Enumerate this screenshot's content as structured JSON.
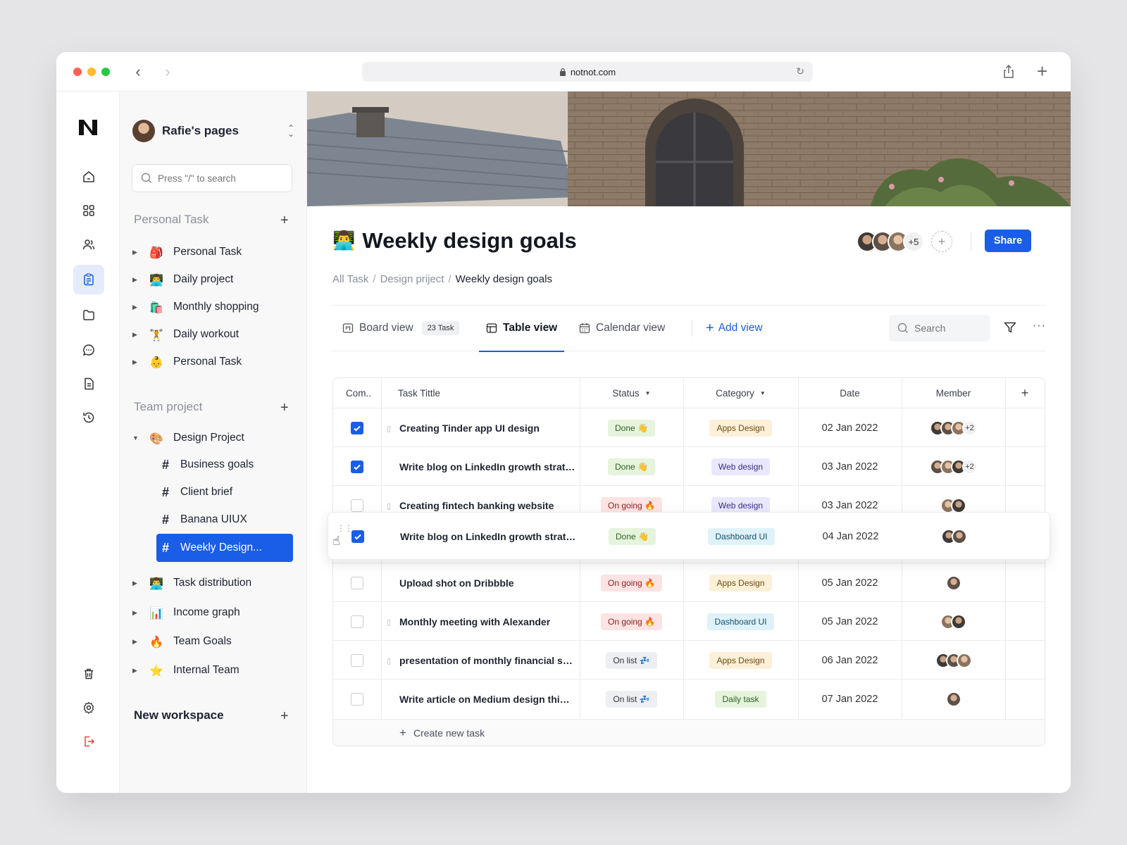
{
  "browser": {
    "url": "notnot.com"
  },
  "sidebar": {
    "workspace_name": "Rafie's pages",
    "search_placeholder": "Press \"/\" to search",
    "personal_section": "Personal Task",
    "personal_items": [
      {
        "label": "Personal Task",
        "emoji": "🎒"
      },
      {
        "label": "Daily project",
        "emoji": "👨‍💻"
      },
      {
        "label": "Monthly shopping",
        "emoji": "🛍️"
      },
      {
        "label": "Daily workout",
        "emoji": "🏋️"
      },
      {
        "label": "Personal Task",
        "emoji": "👶"
      }
    ],
    "team_section": "Team project",
    "design_project": {
      "label": "Design Project",
      "emoji": "🎨"
    },
    "design_subitems": [
      "Business goals",
      "Client brief",
      "Banana UIUX",
      "Weekly Design..."
    ],
    "team_items": [
      {
        "label": "Task distribution",
        "emoji": "👨‍💻"
      },
      {
        "label": "Income graph",
        "emoji": "📊"
      },
      {
        "label": "Team Goals",
        "emoji": "🔥"
      },
      {
        "label": "Internal Team",
        "emoji": "⭐"
      }
    ],
    "new_workspace": "New workspace"
  },
  "page": {
    "emoji": "👨‍💻",
    "title": "Weekly design goals",
    "collaborators_more": "+5",
    "share_label": "Share",
    "breadcrumb": [
      "All Task",
      "Design priject",
      "Weekly design goals"
    ]
  },
  "views": {
    "board": "Board view",
    "task_count": "23 Task",
    "table": "Table view",
    "calendar": "Calendar view",
    "add_view": "Add view",
    "search_placeholder": "Search"
  },
  "table": {
    "headers": {
      "complete": "Com..",
      "title": "Task Tittle",
      "status": "Status",
      "category": "Category",
      "date": "Date",
      "member": "Member"
    },
    "rows": [
      {
        "checked": true,
        "doc": true,
        "title": "Creating Tinder app UI design",
        "status": "Done 👋",
        "category": "Apps Design",
        "date": "02 Jan 2022",
        "members_extra": "+2"
      },
      {
        "checked": true,
        "doc": false,
        "title": "Write blog on LinkedIn growth strategy",
        "status": "Done 👋",
        "category": "Web design",
        "date": "03 Jan 2022",
        "members_extra": "+2"
      },
      {
        "checked": false,
        "doc": true,
        "title": "Creating fintech banking website",
        "status": "On going 🔥",
        "category": "Web design",
        "date": "03 Jan 2022",
        "members_extra": ""
      },
      {
        "checked": true,
        "doc": false,
        "title": "Write blog on LinkedIn growth strategy",
        "status": "Done 👋",
        "category": "Dashboard UI",
        "date": "04 Jan 2022",
        "members_extra": ""
      },
      {
        "checked": false,
        "doc": false,
        "title": "Upload shot on Dribbble",
        "status": "On going 🔥",
        "category": "Apps Design",
        "date": "05 Jan 2022",
        "members_extra": ""
      },
      {
        "checked": false,
        "doc": true,
        "title": "Monthly meeting with Alexander",
        "status": "On going 🔥",
        "category": "Dashboard UI",
        "date": "05 Jan 2022",
        "members_extra": ""
      },
      {
        "checked": false,
        "doc": true,
        "title": "presentation of monthly financial stat...",
        "status": "On list 💤",
        "category": "Apps Design",
        "date": "06 Jan 2022",
        "members_extra": ""
      },
      {
        "checked": false,
        "doc": false,
        "title": "Write article on Medium design thinki...",
        "status": "On list 💤",
        "category": "Daily task",
        "date": "07 Jan 2022",
        "members_extra": ""
      }
    ],
    "create_label": "Create new task"
  },
  "colors": {
    "accent": "#1a5de6",
    "done_bg": "#e6f4dd",
    "ongoing_bg": "#fde3e3",
    "onlist_bg": "#eeeff2",
    "apps_design_bg": "#fdf0d8",
    "web_design_bg": "#e9e7fb",
    "dashboard_bg": "#dff2f9",
    "daily_task_bg": "#e6f4dd"
  }
}
